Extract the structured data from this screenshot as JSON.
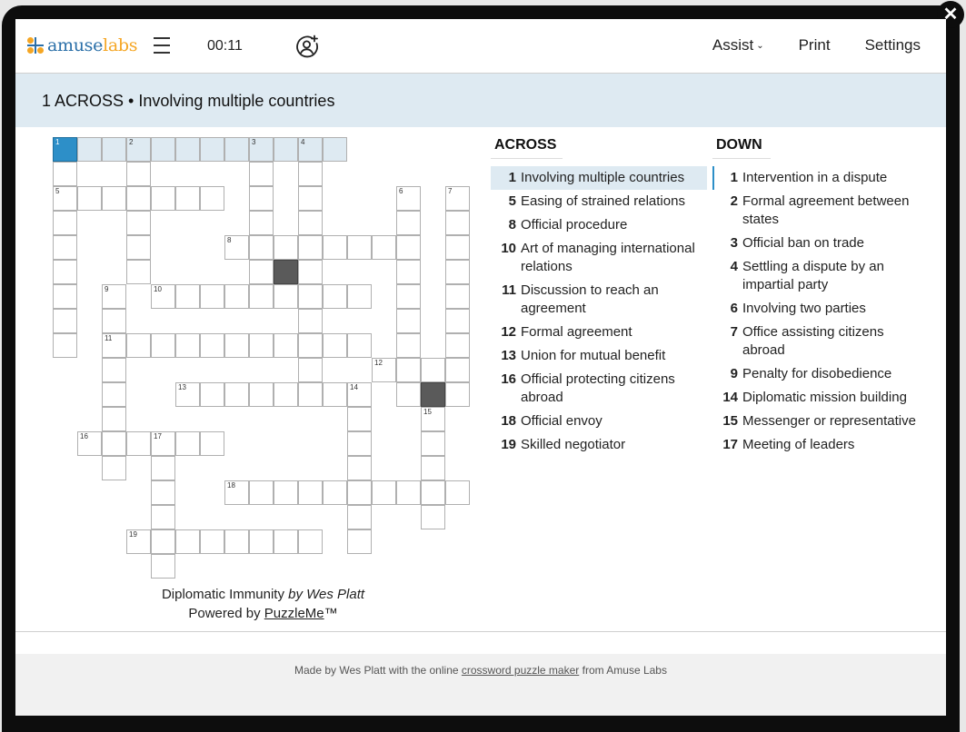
{
  "header": {
    "logo_part1": "amuse",
    "logo_part2": "labs",
    "timer": "00:11",
    "nav": {
      "assist": "Assist",
      "print": "Print",
      "settings": "Settings"
    },
    "close_glyph": "✕"
  },
  "current_clue": "1 ACROSS • Involving multiple countries",
  "grid": {
    "rows": [
      "............     ",
      ".  .    . .      ",
      "....... . .   . .",
      ".  .    . .   . .",
      ".  .   ........ .",
      ".  .    .#.   . .",
      ". . ......... . .",
      ". .       .   . .",
      ". ........... . .",
      "  .       .  ....",
      "  .  ........ .#.",
      "  .         .  . ",
      " ......     .  . ",
      "  . .       .  . ",
      "    .  ..........",
      "    .       .  . ",
      "   ........ .    ",
      "    .            "
    ],
    "numbers": [
      {
        "n": "1",
        "r": 0,
        "c": 0
      },
      {
        "n": "2",
        "r": 0,
        "c": 3
      },
      {
        "n": "3",
        "r": 0,
        "c": 8
      },
      {
        "n": "4",
        "r": 0,
        "c": 10
      },
      {
        "n": "5",
        "r": 2,
        "c": 0
      },
      {
        "n": "6",
        "r": 2,
        "c": 14
      },
      {
        "n": "7",
        "r": 2,
        "c": 16
      },
      {
        "n": "8",
        "r": 4,
        "c": 7
      },
      {
        "n": "9",
        "r": 6,
        "c": 2
      },
      {
        "n": "10",
        "r": 6,
        "c": 4
      },
      {
        "n": "11",
        "r": 8,
        "c": 2
      },
      {
        "n": "12",
        "r": 9,
        "c": 13
      },
      {
        "n": "13",
        "r": 10,
        "c": 5
      },
      {
        "n": "14",
        "r": 10,
        "c": 12
      },
      {
        "n": "15",
        "r": 11,
        "c": 15
      },
      {
        "n": "16",
        "r": 12,
        "c": 1
      },
      {
        "n": "17",
        "r": 12,
        "c": 4
      },
      {
        "n": "18",
        "r": 14,
        "c": 7
      },
      {
        "n": "19",
        "r": 16,
        "c": 3
      }
    ],
    "selected_cell": {
      "r": 0,
      "c": 0
    },
    "highlighted_word": {
      "r": 0,
      "c_start": 0,
      "c_end": 11
    }
  },
  "credits": {
    "title": "Diplomatic Immunity",
    "by": "by Wes Platt",
    "powered_by": "Powered by",
    "powered_link": "PuzzleMe",
    "tm": "™"
  },
  "clues": {
    "across_heading": "ACROSS",
    "down_heading": "DOWN",
    "across": [
      {
        "num": "1",
        "text": "Involving multiple countries",
        "active": true
      },
      {
        "num": "5",
        "text": "Easing of strained relations"
      },
      {
        "num": "8",
        "text": "Official procedure"
      },
      {
        "num": "10",
        "text": "Art of managing international relations"
      },
      {
        "num": "11",
        "text": "Discussion to reach an agreement"
      },
      {
        "num": "12",
        "text": "Formal agreement"
      },
      {
        "num": "13",
        "text": "Union for mutual benefit"
      },
      {
        "num": "16",
        "text": "Official protecting citizens abroad"
      },
      {
        "num": "18",
        "text": "Official envoy"
      },
      {
        "num": "19",
        "text": "Skilled negotiator"
      }
    ],
    "down": [
      {
        "num": "1",
        "text": "Intervention in a dispute",
        "crossing": true
      },
      {
        "num": "2",
        "text": "Formal agreement between states"
      },
      {
        "num": "3",
        "text": "Official ban on trade"
      },
      {
        "num": "4",
        "text": "Settling a dispute by an impartial party"
      },
      {
        "num": "6",
        "text": "Involving two parties"
      },
      {
        "num": "7",
        "text": "Office assisting citizens abroad"
      },
      {
        "num": "9",
        "text": "Penalty for disobedience"
      },
      {
        "num": "14",
        "text": "Diplomatic mission building"
      },
      {
        "num": "15",
        "text": "Messenger or representative"
      },
      {
        "num": "17",
        "text": "Meeting of leaders"
      }
    ]
  },
  "footer": {
    "prefix": "Made by Wes Platt with the online",
    "link": "crossword puzzle maker",
    "suffix": "from Amuse Labs"
  },
  "colors": {
    "accent": "#2d8fc8",
    "highlight": "#deeaf2",
    "block": "#5a5a5a",
    "logo_blue": "#2a6fa8",
    "logo_orange": "#f5a623"
  }
}
